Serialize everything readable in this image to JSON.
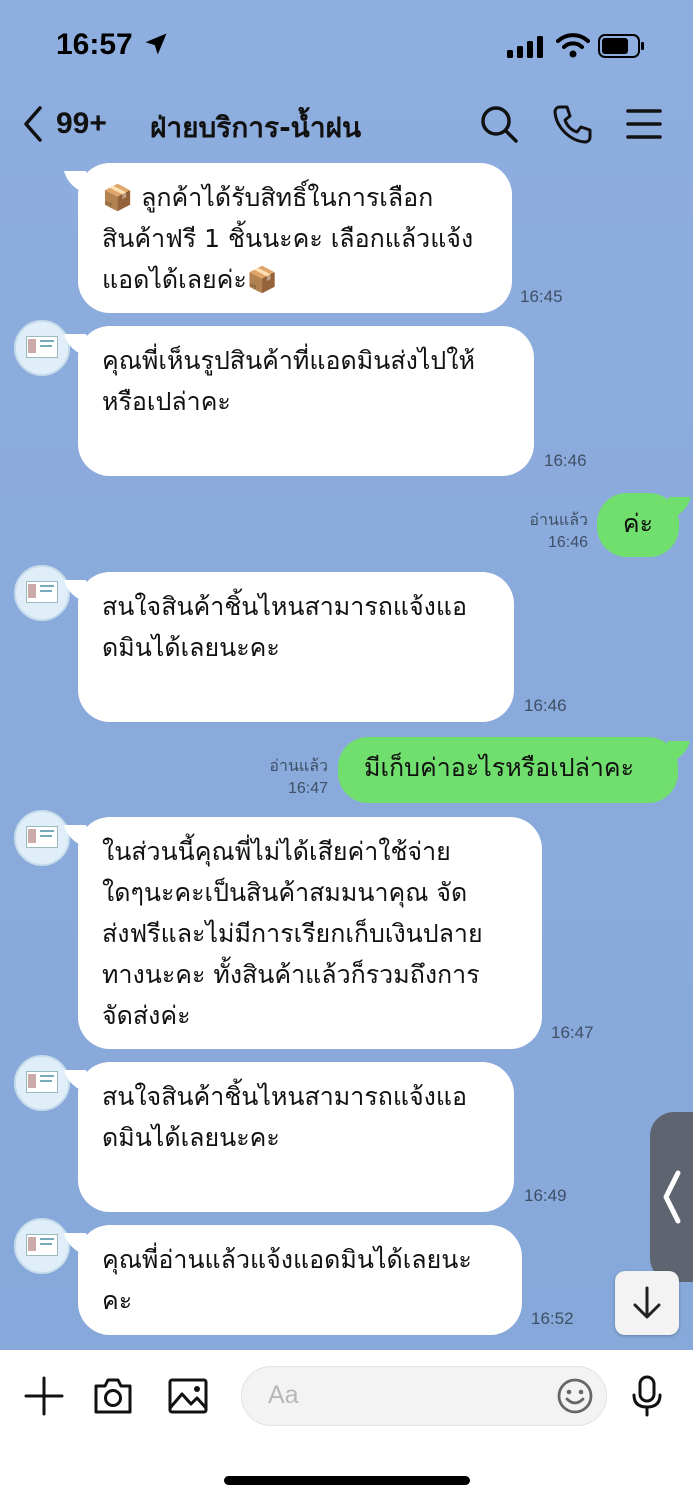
{
  "status": {
    "time": "16:57"
  },
  "header": {
    "back_count": "99+",
    "title": "ฝ่ายบริการ-น้ำฝน"
  },
  "messages": [
    {
      "text": "📦 ลูกค้าได้รับสิทธิ์ในการเลือก\nสินค้าฟรี 1 ชิ้นนะคะ เลือกแล้วแจ้ง\nแอดได้เลยค่ะ📦",
      "time": "16:45"
    },
    {
      "text": "คุณพี่เห็นรูปสินค้าที่แอดมินส่งไปให้\nหรือเปล่าคะ",
      "time": "16:46"
    },
    {
      "text": "ค่ะ",
      "time": "16:46",
      "read": "อ่านแล้ว"
    },
    {
      "text": "สนใจสินค้าชิ้นไหนสามารถแจ้งแอ\nดมินได้เลยนะคะ",
      "time": "16:46"
    },
    {
      "text": "มีเก็บค่าอะไรหรือเปล่าคะ",
      "time": "16:47",
      "read": "อ่านแล้ว"
    },
    {
      "text": "ในส่วนนี้คุณพี่ไม่ได้เสียค่าใช้จ่าย\nใดๆนะคะเป็นสินค้าสมมนาคุณ จัด\nส่งฟรีและไม่มีการเรียกเก็บเงินปลาย\nทางนะคะ ทั้งสินค้าแล้วก็รวมถึงการ\nจัดส่งค่ะ",
      "time": "16:47"
    },
    {
      "text": "สนใจสินค้าชิ้นไหนสามารถแจ้งแอ\nดมินได้เลยนะคะ",
      "time": "16:49"
    },
    {
      "text": "คุณพี่อ่านแล้วแจ้งแอดมินได้เลยนะ\nคะ",
      "time": "16:52"
    }
  ],
  "input": {
    "placeholder": "Aa"
  },
  "icons": {
    "back": "chevron-left-icon",
    "search": "search-icon",
    "call": "phone-icon",
    "menu": "menu-icon",
    "add": "plus-icon",
    "camera": "camera-icon",
    "image": "image-icon",
    "emoji": "emoji-icon",
    "mic": "microphone-icon"
  },
  "colors": {
    "outgoing_bubble": "#70df6d",
    "incoming_bubble": "#ffffff",
    "chat_background": "#8aaadb"
  }
}
